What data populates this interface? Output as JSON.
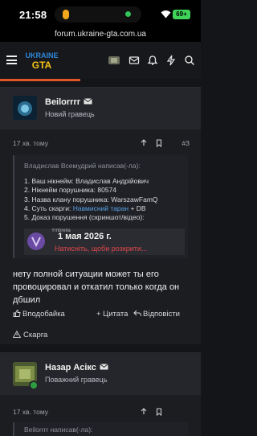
{
  "status_bar": {
    "time": "21:58",
    "battery": "69+"
  },
  "browser": {
    "url": "forum.ukraine-gta.com.ua"
  },
  "header": {
    "logo_text": "UKRAINE GTA",
    "icons": [
      "menu-icon",
      "avatar-thumb",
      "inbox-icon",
      "alerts-icon",
      "whats-new-icon",
      "search-icon"
    ]
  },
  "posts": [
    {
      "username": "Beilorrrr",
      "user_title": "Новий гравець",
      "time": "17 хв. тому",
      "post_number": "#3",
      "quote": {
        "header": "Владислав Всемудрий написав(-ла):",
        "lines": [
          {
            "text": "1. Ваш нікнейм: Владислав Андрійович"
          },
          {
            "text": "2. Нікнейм порушника: 80574"
          },
          {
            "text": "3. Назва клану порушника: WarszawFamQ"
          },
          {
            "prefix": "4. Суть скарги: ",
            "highlight": "Навмисний таран",
            "suffix": " + DB"
          },
          {
            "text": "5. Доказ порушення (скриншот/відео):"
          }
        ],
        "media": {
          "handle": "Ymbrella",
          "date": "1 мая 2026 г.",
          "link": "Натисніть, щоби розкрити..."
        }
      },
      "body": "нету полной ситуации может ты его провоцировал и откатил только когда он дбшил",
      "actions": {
        "like": "Вподобайка",
        "quote": "+ Цитата",
        "reply": "Відповісти"
      },
      "report": "Скарга"
    },
    {
      "username": "Назар Асікс",
      "user_title": "Поважний гравець",
      "time": "17 хв. тому",
      "quote_header": "Beilorrrr написав(-ла):"
    }
  ],
  "colors": {
    "accent": "#e05529",
    "link": "#5aa2e6",
    "media_link": "#e0484e",
    "online": "#2c9e3f"
  }
}
